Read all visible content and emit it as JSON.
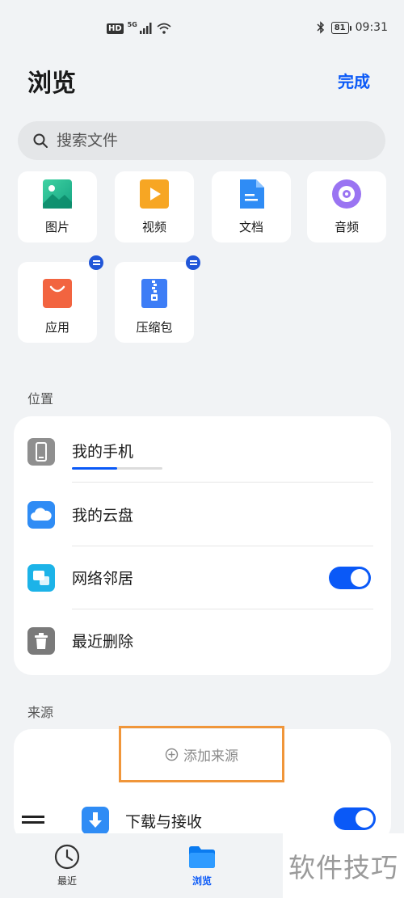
{
  "status_bar": {
    "hd": "HD",
    "network": "5G",
    "battery": "81",
    "time": "09:31"
  },
  "header": {
    "title": "浏览",
    "done_label": "完成"
  },
  "search": {
    "placeholder": "搜索文件"
  },
  "categories": [
    {
      "label": "图片",
      "icon": "image-icon"
    },
    {
      "label": "视频",
      "icon": "video-icon"
    },
    {
      "label": "文档",
      "icon": "document-icon"
    },
    {
      "label": "音频",
      "icon": "audio-icon"
    },
    {
      "label": "应用",
      "icon": "app-bag-icon",
      "removable": true
    },
    {
      "label": "压缩包",
      "icon": "zip-icon",
      "removable": true
    }
  ],
  "locations": {
    "section_label": "位置",
    "items": [
      {
        "label": "我的手机",
        "icon": "phone-icon",
        "storage_used_fraction": 0.5
      },
      {
        "label": "我的云盘",
        "icon": "cloud-icon"
      },
      {
        "label": "网络邻居",
        "icon": "network-icon",
        "toggle_on": true
      },
      {
        "label": "最近删除",
        "icon": "trash-icon"
      }
    ]
  },
  "sources": {
    "section_label": "来源",
    "add_label": "添加来源",
    "items": [
      {
        "label": "下载与接收",
        "icon": "download-icon",
        "toggle_on": true
      }
    ]
  },
  "bottom_nav": {
    "items": [
      {
        "label": "最近",
        "icon": "clock-icon",
        "active": false
      },
      {
        "label": "浏览",
        "icon": "folder-icon",
        "active": true
      }
    ]
  },
  "watermark": "软件技巧",
  "colors": {
    "accent": "#0a59f7",
    "highlight_border": "#f0963a",
    "background": "#f1f3f5"
  }
}
